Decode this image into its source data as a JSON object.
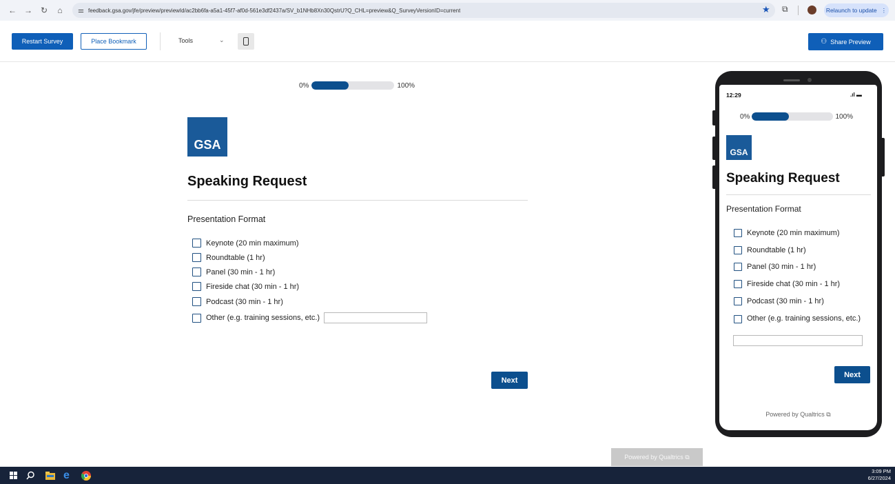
{
  "browser": {
    "url": "feedback.gsa.gov/jfe/preview/previewId/ac2bb6fa-a5a1-45f7-af0d-561e3df2437a/SV_b1NHb8Xn30QstrU?Q_CHL=preview&Q_SurveyVersionID=current",
    "relaunch_label": "Relaunch to update"
  },
  "toolbar": {
    "restart_label": "Restart Survey",
    "bookmark_label": "Place Bookmark",
    "tools_label": "Tools",
    "share_label": "Share Preview"
  },
  "survey": {
    "progress": {
      "start_label": "0%",
      "end_label": "100%",
      "fraction": 0.45
    },
    "logo_text": "GSA",
    "title": "Speaking Request",
    "question": "Presentation Format",
    "choices": [
      "Keynote (20 min maximum)",
      "Roundtable (1 hr)",
      "Panel (30 min - 1 hr)",
      "Fireside chat (30 min - 1 hr)",
      "Podcast (30 min - 1 hr)",
      "Other (e.g. training sessions, etc.)"
    ],
    "other_input_value": "",
    "next_label": "Next"
  },
  "phone": {
    "time": "12:29",
    "powered_by": "Powered by Qualtrics ⧉"
  },
  "footer": {
    "powered_by": "Powered by Qualtrics ⧉"
  },
  "taskbar": {
    "time": "3:09 PM",
    "date": "6/27/2024"
  },
  "colors": {
    "brand_blue": "#0f5fb8",
    "survey_blue": "#0c4f8e",
    "gsa_blue": "#1a5a99"
  }
}
